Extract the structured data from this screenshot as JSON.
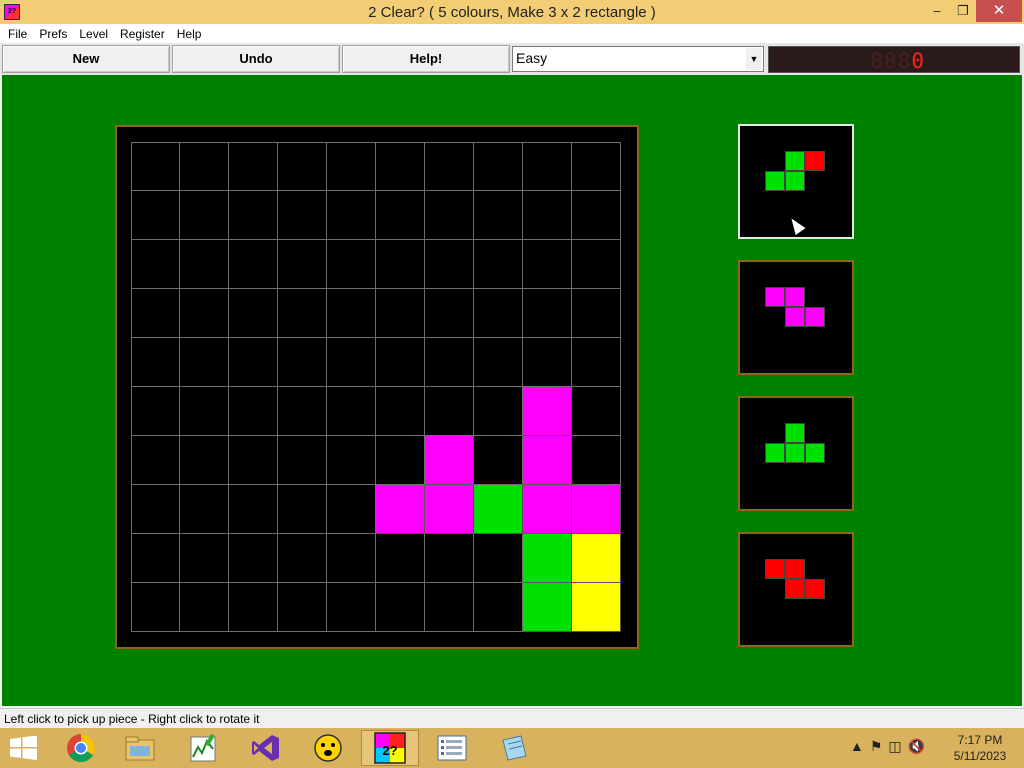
{
  "window": {
    "title": "2 Clear?   ( 5 colours, Make 3 x 2 rectangle )",
    "icon_text": "2?",
    "min_glyph": "–",
    "max_glyph": "❐",
    "close_glyph": "✕"
  },
  "menu": [
    "File",
    "Prefs",
    "Level",
    "Register",
    "Help"
  ],
  "toolbar": {
    "new_label": "New",
    "undo_label": "Undo",
    "help_label": "Help!",
    "level_value": "Easy",
    "dropdown_arrow": "▼",
    "counter_dim": "888",
    "counter_lit": "0"
  },
  "colors": {
    "magenta": "#ff00ff",
    "green": "#00e000",
    "yellow": "#ffff00",
    "red": "#ff0000",
    "empty": "#000000",
    "table_green": "#008000"
  },
  "board": {
    "rows": 10,
    "cols": 10,
    "cells": [
      {
        "r": 5,
        "c": 8,
        "color": "magenta"
      },
      {
        "r": 6,
        "c": 6,
        "color": "magenta"
      },
      {
        "r": 6,
        "c": 8,
        "color": "magenta"
      },
      {
        "r": 7,
        "c": 5,
        "color": "magenta"
      },
      {
        "r": 7,
        "c": 6,
        "color": "magenta"
      },
      {
        "r": 7,
        "c": 7,
        "color": "green"
      },
      {
        "r": 7,
        "c": 8,
        "color": "magenta"
      },
      {
        "r": 7,
        "c": 9,
        "color": "magenta"
      },
      {
        "r": 8,
        "c": 8,
        "color": "green"
      },
      {
        "r": 8,
        "c": 9,
        "color": "yellow"
      },
      {
        "r": 9,
        "c": 8,
        "color": "green"
      },
      {
        "r": 9,
        "c": 9,
        "color": "yellow"
      }
    ]
  },
  "pieces": [
    {
      "name": "piece-1",
      "selected": true,
      "cells": [
        [
          0,
          1,
          "green"
        ],
        [
          0,
          2,
          "red"
        ],
        [
          1,
          0,
          "green"
        ],
        [
          1,
          1,
          "green"
        ]
      ]
    },
    {
      "name": "piece-2",
      "selected": false,
      "cells": [
        [
          0,
          0,
          "magenta"
        ],
        [
          0,
          1,
          "magenta"
        ],
        [
          1,
          1,
          "magenta"
        ],
        [
          1,
          2,
          "magenta"
        ]
      ]
    },
    {
      "name": "piece-3",
      "selected": false,
      "cells": [
        [
          0,
          1,
          "green"
        ],
        [
          1,
          0,
          "green"
        ],
        [
          1,
          1,
          "green"
        ],
        [
          1,
          2,
          "green"
        ]
      ]
    },
    {
      "name": "piece-4",
      "selected": false,
      "cells": [
        [
          0,
          0,
          "red"
        ],
        [
          0,
          1,
          "red"
        ],
        [
          1,
          1,
          "red"
        ],
        [
          1,
          2,
          "red"
        ]
      ]
    }
  ],
  "status": "Left click to pick up piece - Right click to rotate it",
  "taskbar": {
    "apps": [
      "chrome-icon",
      "file-explorer-icon",
      "chart-app-icon",
      "visual-studio-icon",
      "smiley-app-icon",
      "2clear-app-icon",
      "list-app-icon",
      "notepad-icon"
    ],
    "active_app": "2clear-app-icon",
    "time": "7:17 PM",
    "date": "5/11/2023"
  }
}
